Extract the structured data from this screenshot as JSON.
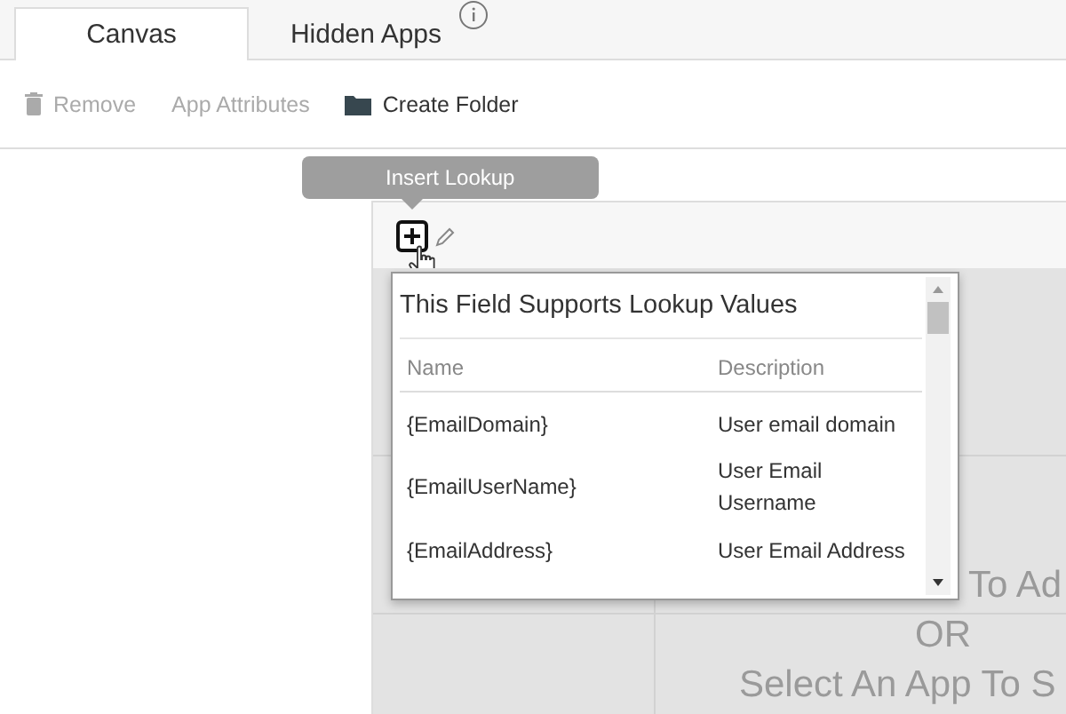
{
  "tabs": [
    {
      "label": "Canvas",
      "selected": true
    },
    {
      "label": "Hidden Apps",
      "selected": false
    }
  ],
  "toolbar": [
    {
      "kind": "trash",
      "label": "Remove",
      "disabled": true
    },
    {
      "kind": "plain",
      "label": "App Attributes",
      "disabled": true
    },
    {
      "kind": "folder",
      "label": "Create Folder",
      "disabled": false
    }
  ],
  "tooltip": {
    "text": "Insert Lookup"
  },
  "lookup_popup": {
    "title": "This Field Supports Lookup Values",
    "columns": [
      "Name",
      "Description"
    ],
    "rows": [
      {
        "name": "{EmailDomain}",
        "description": "User email domain"
      },
      {
        "name": "{EmailUserName}",
        "description": "User Email Username"
      },
      {
        "name": "{EmailAddress}",
        "description": "User Email Address"
      }
    ]
  },
  "canvas": {
    "lines": [
      "To Ad",
      "OR",
      "Select An App To S"
    ]
  }
}
